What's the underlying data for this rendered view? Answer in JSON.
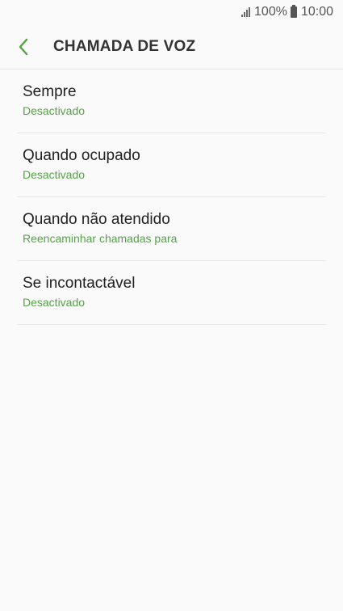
{
  "status_bar": {
    "battery_percent": "100%",
    "time": "10:00",
    "icons": [
      "signal-icon",
      "battery-icon"
    ]
  },
  "header": {
    "title": "CHAMADA DE VOZ",
    "back_icon": "chevron-left-icon"
  },
  "colors": {
    "accent": "#52a443",
    "background": "#fafafa"
  },
  "settings": {
    "items": [
      {
        "label": "Sempre",
        "value": "Desactivado"
      },
      {
        "label": "Quando ocupado",
        "value": "Desactivado"
      },
      {
        "label": "Quando não atendido",
        "value": "Reencaminhar chamadas para"
      },
      {
        "label": "Se incontactável",
        "value": "Desactivado"
      }
    ]
  }
}
